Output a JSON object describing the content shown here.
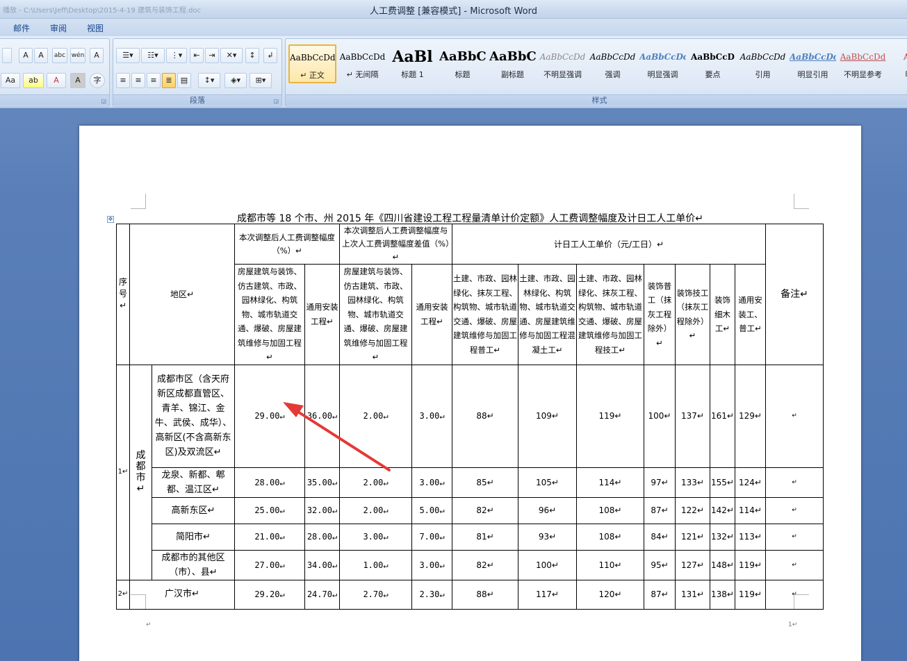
{
  "window": {
    "path": "播放 - C:\\Users\\Jeff\\Desktop\\2015-4-19 建筑与装饰工程.doc",
    "title": "人工费调整 [兼容模式] - Microsoft Word"
  },
  "tabs": [
    "邮件",
    "审阅",
    "视图"
  ],
  "ribbon": {
    "font_group_label": "",
    "paragraph_group_label": "段落",
    "styles_group_label": "样式",
    "font_buttons": [
      "A",
      "A",
      "abc",
      "wén",
      "A",
      "Aa",
      "ab",
      "A",
      "A",
      "字"
    ],
    "styles": [
      {
        "preview": "AaBbCcDd",
        "name": "↵ 正文",
        "selected": true
      },
      {
        "preview": "AaBbCcDd",
        "name": "↵ 无间隔"
      },
      {
        "preview": "AaBl",
        "name": "标题 1"
      },
      {
        "preview": "AaBbC",
        "name": "标题"
      },
      {
        "preview": "AaBbC",
        "name": "副标题"
      },
      {
        "preview": "AaBbCcDd",
        "name": "不明显强调"
      },
      {
        "preview": "AaBbCcDd",
        "name": "强调"
      },
      {
        "preview": "AaBbCcDd",
        "name": "明显强调"
      },
      {
        "preview": "AaBbCcD",
        "name": "要点"
      },
      {
        "preview": "AaBbCcDd",
        "name": "引用"
      },
      {
        "preview": "AaBbCcDd",
        "name": "明显引用"
      },
      {
        "preview": "AaBbCcDd",
        "name": "不明显参考"
      },
      {
        "preview": "AaB",
        "name": "明显"
      }
    ]
  },
  "document": {
    "title": "成都市等 18 个市、州 2015 年《四川省建设工程工程量清单计价定额》人工费调整幅度及计日工人工单价↵",
    "headers": {
      "seq": "序号↵",
      "region": "地区↵",
      "group1": "本次调整后人工费调整幅度（%）↵",
      "group2": "本次调整后人工费调整幅度与上次人工费调整幅度差值（%）↵",
      "group3": "计日工人工单价（元/工日）↵",
      "remark": "备注↵",
      "g1c1": "房屋建筑与装饰、仿古建筑、市政、园林绿化、构筑物、城市轨道交通、爆破、房屋建筑维修与加固工程↵",
      "g1c2": "通用安装工程↵",
      "g2c1": "房屋建筑与装饰、仿古建筑、市政、园林绿化、构筑物、城市轨道交通、爆破、房屋建筑维修与加固工程↵",
      "g2c2": "通用安装工程↵",
      "g3c1": "土建、市政、园林绿化、抹灰工程、构筑物、城市轨道交通、爆破、房屋建筑维修与加固工程普工↵",
      "g3c2": "土建、市政、园林绿化、构筑物、城市轨道交通、房屋建筑维修与加固工程混凝土工↵",
      "g3c3": "土建、市政、园林绿化、抹灰工程、构筑物、城市轨道交通、爆破、房屋建筑维修与加固工程技工↵",
      "g3c4": "装饰普工（抹灰工程除外）↵",
      "g3c5": "装饰技工（抹灰工程除外）↵",
      "g3c6": "装饰细木工↵",
      "g3c7": "通用安装工、普工↵"
    },
    "group_1": {
      "seq": "1↵",
      "city": "成都市↵"
    },
    "rows": [
      {
        "region": "成都市区（含天府新区成都直管区、青羊、锦江、金牛、武侯、成华）、高新区(不含高新东区)及双流区↵",
        "v": [
          "29.00↵",
          "36.00↵",
          "2.00↵",
          "3.00↵",
          "88↵",
          "109↵",
          "119↵",
          "100↵",
          "137↵",
          "161↵",
          "129↵"
        ],
        "remark": "↵"
      },
      {
        "region": "龙泉、新都、郫都、温江区↵",
        "v": [
          "28.00↵",
          "35.00↵",
          "2.00↵",
          "3.00↵",
          "85↵",
          "105↵",
          "114↵",
          "97↵",
          "133↵",
          "155↵",
          "124↵"
        ],
        "remark": "↵"
      },
      {
        "region": "高新东区↵",
        "v": [
          "25.00↵",
          "32.00↵",
          "2.00↵",
          "5.00↵",
          "82↵",
          "96↵",
          "108↵",
          "87↵",
          "122↵",
          "142↵",
          "114↵"
        ],
        "remark": "↵"
      },
      {
        "region": "简阳市↵",
        "v": [
          "21.00↵",
          "28.00↵",
          "3.00↵",
          "7.00↵",
          "81↵",
          "93↵",
          "108↵",
          "84↵",
          "121↵",
          "132↵",
          "113↵"
        ],
        "remark": "↵"
      },
      {
        "region": "成都市的其他区（市）、县↵",
        "v": [
          "27.00↵",
          "34.00↵",
          "1.00↵",
          "3.00↵",
          "82↵",
          "100↵",
          "110↵",
          "95↵",
          "127↵",
          "148↵",
          "119↵"
        ],
        "remark": "↵"
      }
    ],
    "row2": {
      "seq": "2↵",
      "region": "广汉市↵",
      "v": [
        "29.20↵",
        "24.70↵",
        "2.70↵",
        "2.30↵",
        "88↵",
        "117↵",
        "120↵",
        "87↵",
        "131↵",
        "138↵",
        "119↵"
      ],
      "remark": "↵"
    },
    "end_mark": "↵",
    "page_mark": "1↵"
  },
  "colors": {
    "arrow": "#e53935",
    "selected_style": "#e9b43b"
  }
}
